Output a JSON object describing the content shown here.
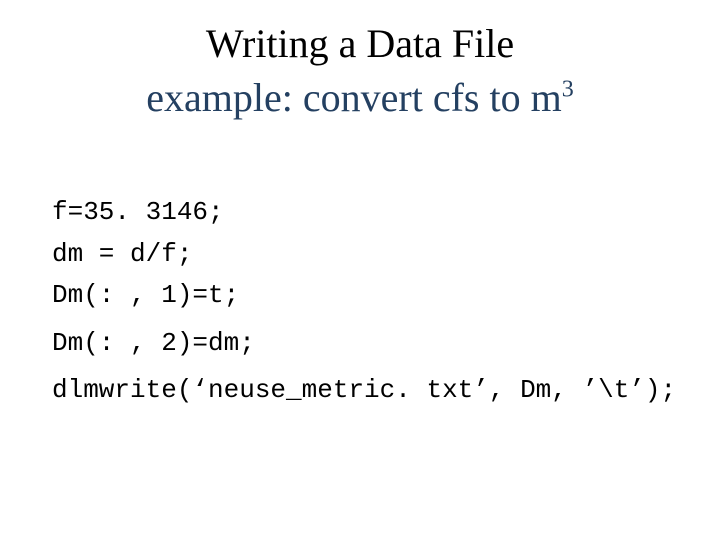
{
  "title": "Writing a Data File",
  "subtitle_prefix": "example: convert cfs to m",
  "subtitle_sup": "3",
  "code": {
    "line1": "f=35. 3146;",
    "line2": "dm = d/f;",
    "line3": "Dm(: , 1)=t;",
    "line4": "Dm(: , 2)=dm;",
    "line5": "dlmwrite(‘neuse_metric. txt’, Dm, ’\\t’);"
  }
}
